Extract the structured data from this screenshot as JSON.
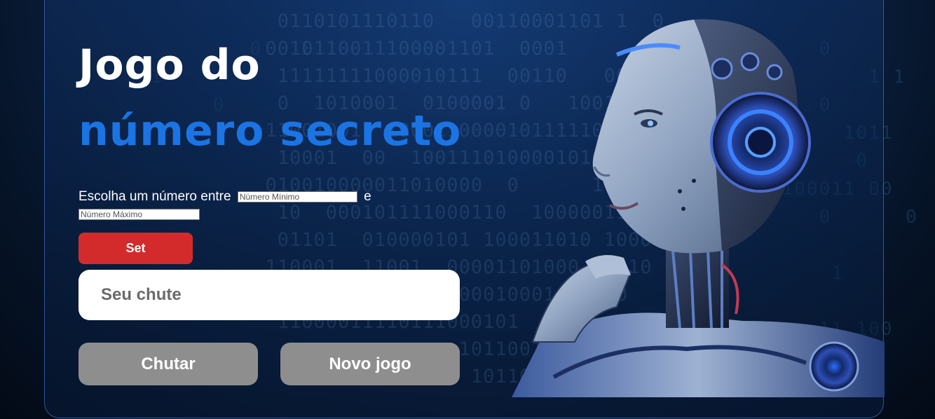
{
  "title": {
    "line1": "Jogo do",
    "line2": "número secreto"
  },
  "range": {
    "label_before": "Escolha um número entre",
    "min_placeholder": "Número Mínimo",
    "connector": "e",
    "max_placeholder": "Número Máximo",
    "set_label": "Set"
  },
  "guess": {
    "placeholder": "Seu chute"
  },
  "buttons": {
    "guess_label": "Chutar",
    "new_game_label": "Novo jogo"
  },
  "colors": {
    "title_white": "#ffffff",
    "title_accent": "#1b74e4",
    "set_button": "#d32b2b",
    "action_button": "#8e8e8e"
  },
  "illustration": {
    "icon": "robot-head-illustration"
  }
}
